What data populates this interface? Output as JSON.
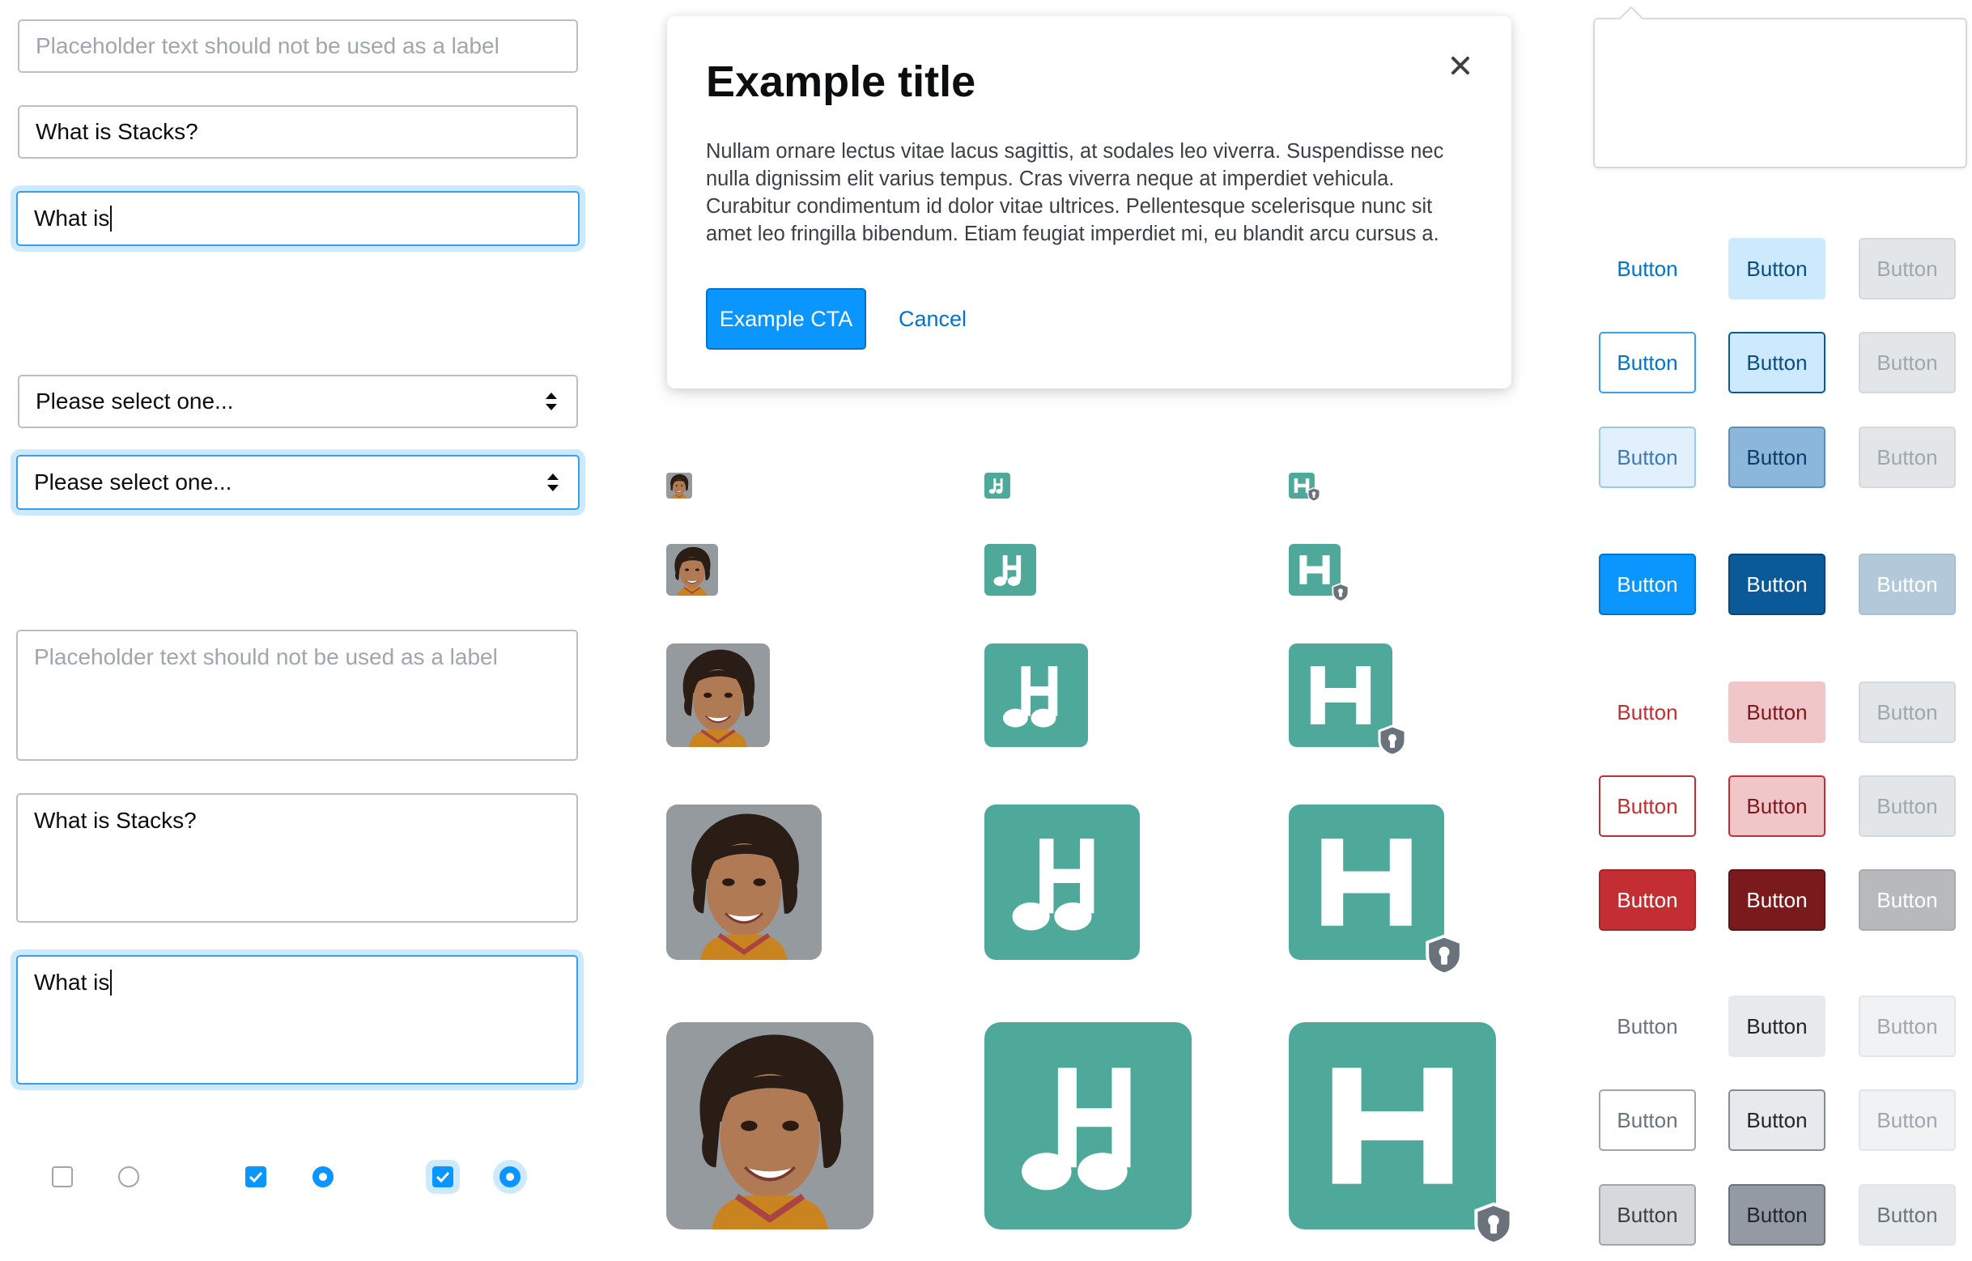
{
  "forms": {
    "input_placeholder": "Placeholder text should not be used as a label",
    "input_value": "What is Stacks?",
    "input_focused_value": "What is",
    "select_label": "Please select one...",
    "select_focused_label": "Please select one...",
    "textarea_placeholder": "Placeholder text should not be used as a label",
    "textarea_value": "What is Stacks?",
    "textarea_focused_value": "What is",
    "checkboxes": [
      {
        "type": "checkbox",
        "checked": false,
        "focused": false
      },
      {
        "type": "radio",
        "checked": false,
        "focused": false
      },
      {
        "type": "checkbox",
        "checked": true,
        "focused": false
      },
      {
        "type": "radio",
        "checked": true,
        "focused": false
      },
      {
        "type": "checkbox",
        "checked": true,
        "focused": true
      },
      {
        "type": "radio",
        "checked": true,
        "focused": true
      }
    ]
  },
  "modal": {
    "title": "Example title",
    "body": "Nullam ornare lectus vitae lacus sagittis, at sodales leo viverra. Suspendisse nec nulla dignissim elit varius tempus. Cras viverra neque at imperdiet vehicula. Curabitur condimentum id dolor vitae ultrices. Pellentesque scelerisque nunc sit amet leo fringilla bibendum. Etiam feugiat imperdiet mi, eu blandit arcu cursus a.",
    "cta_label": "Example CTA",
    "cancel_label": "Cancel",
    "close_icon": "close-icon"
  },
  "avatars": {
    "tile_color": "#4fa99b",
    "shield_color": "#6a737c",
    "columns": [
      "user-photo",
      "site-icon-music",
      "site-icon-h-with-shield"
    ],
    "tile_letter": "H"
  },
  "buttons": {
    "label": "Button",
    "rows": [
      [
        "Button",
        "Button",
        "Button"
      ],
      [
        "Button",
        "Button",
        "Button"
      ],
      [
        "Button",
        "Button",
        "Button"
      ],
      [
        "Button",
        "Button",
        "Button"
      ],
      [
        "Button",
        "Button",
        "Button"
      ],
      [
        "Button",
        "Button",
        "Button"
      ],
      [
        "Button",
        "Button",
        "Button"
      ],
      [
        "Button",
        "Button",
        "Button"
      ],
      [
        "Button",
        "Button",
        "Button"
      ],
      [
        "Button",
        "Button",
        "Button"
      ]
    ],
    "colors": {
      "blue": "#0a95ff",
      "blue_dark": "#0a5a99",
      "red": "#c22e32",
      "red_dark": "#7a1a1d",
      "muted": "#6a737c"
    }
  }
}
